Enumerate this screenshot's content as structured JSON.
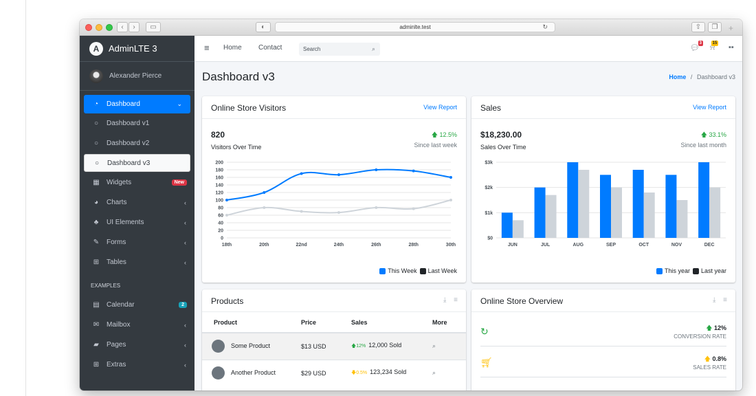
{
  "browser": {
    "url": "adminlte.test"
  },
  "sidebar": {
    "brand": "AdminLTE 3",
    "brand_logo": "A",
    "user_name": "Alexander Pierce",
    "items": [
      {
        "label": "Dashboard",
        "icon": "dashboard-icon"
      },
      {
        "label": "Dashboard v1",
        "icon": "circle-icon"
      },
      {
        "label": "Dashboard v2",
        "icon": "circle-icon"
      },
      {
        "label": "Dashboard v3",
        "icon": "circle-icon"
      },
      {
        "label": "Widgets",
        "icon": "grid-icon",
        "badge": "New"
      },
      {
        "label": "Charts",
        "icon": "pie-chart-icon"
      },
      {
        "label": "UI Elements",
        "icon": "tree-icon"
      },
      {
        "label": "Forms",
        "icon": "edit-icon"
      },
      {
        "label": "Tables",
        "icon": "table-icon"
      }
    ],
    "examples_header": "EXAMPLES",
    "examples": [
      {
        "label": "Calendar",
        "icon": "calendar-icon",
        "badge": "2"
      },
      {
        "label": "Mailbox",
        "icon": "envelope-icon"
      },
      {
        "label": "Pages",
        "icon": "book-icon"
      },
      {
        "label": "Extras",
        "icon": "plus-square-icon"
      }
    ]
  },
  "topnav": {
    "home": "Home",
    "contact": "Contact",
    "search_placeholder": "Search",
    "messages_badge": "3",
    "notifications_badge": "15"
  },
  "content": {
    "title": "Dashboard v3",
    "breadcrumb_home": "Home",
    "breadcrumb_sep": "/",
    "breadcrumb_current": "Dashboard v3"
  },
  "visitors": {
    "title": "Online Store Visitors",
    "link": "View Report",
    "value": "820",
    "label": "Visitors Over Time",
    "change": "12.5%",
    "since": "Since last week",
    "legend_this": "This Week",
    "legend_last": "Last Week"
  },
  "sales": {
    "title": "Sales",
    "link": "View Report",
    "value": "$18,230.00",
    "label": "Sales Over Time",
    "change": "33.1%",
    "since": "Since last month",
    "legend_this": "This year",
    "legend_last": "Last year"
  },
  "products": {
    "title": "Products",
    "headers": [
      "Product",
      "Price",
      "Sales",
      "More"
    ],
    "rows": [
      {
        "name": "Some Product",
        "price": "$13 USD",
        "change": "12%",
        "trend": "up",
        "sold": "12,000 Sold"
      },
      {
        "name": "Another Product",
        "price": "$29 USD",
        "change": "0.5%",
        "trend": "down",
        "sold": "123,234 Sold"
      }
    ]
  },
  "overview": {
    "title": "Online Store Overview",
    "rows": [
      {
        "value": "12%",
        "label": "CONVERSION RATE",
        "icon": "refresh-icon",
        "color": "#28a745"
      },
      {
        "value": "0.8%",
        "label": "SALES RATE",
        "icon": "cart-icon",
        "color": "#ffc107"
      }
    ]
  },
  "colors": {
    "primary": "#007bff",
    "gray": "#ced4da",
    "dark": "#343a40",
    "success": "#28a745",
    "warning": "#ffc107",
    "danger": "#dc3545",
    "info": "#17a2b8"
  },
  "chart_data": [
    {
      "type": "line",
      "x": [
        "18th",
        "20th",
        "22nd",
        "24th",
        "26th",
        "28th",
        "30th"
      ],
      "series": [
        {
          "name": "This Week",
          "values": [
            100,
            120,
            170,
            167,
            180,
            177,
            160
          ]
        },
        {
          "name": "Last Week",
          "values": [
            60,
            80,
            70,
            67,
            80,
            77,
            100
          ]
        }
      ],
      "ylim": [
        0,
        200
      ],
      "yticks": [
        0,
        20,
        40,
        60,
        80,
        100,
        120,
        140,
        160,
        180,
        200
      ],
      "grid": true,
      "legend": "bottom-right"
    },
    {
      "type": "bar",
      "categories": [
        "JUN",
        "JUL",
        "AUG",
        "SEP",
        "OCT",
        "NOV",
        "DEC"
      ],
      "series": [
        {
          "name": "This year",
          "values": [
            1000,
            2000,
            3000,
            2500,
            2700,
            2500,
            3000
          ]
        },
        {
          "name": "Last year",
          "values": [
            700,
            1700,
            2700,
            2000,
            1800,
            1500,
            2000
          ]
        }
      ],
      "ylim": [
        0,
        3000
      ],
      "yticks": [
        "$0",
        "$1k",
        "$2k",
        "$3k"
      ],
      "grid": true,
      "legend": "bottom-right"
    }
  ]
}
